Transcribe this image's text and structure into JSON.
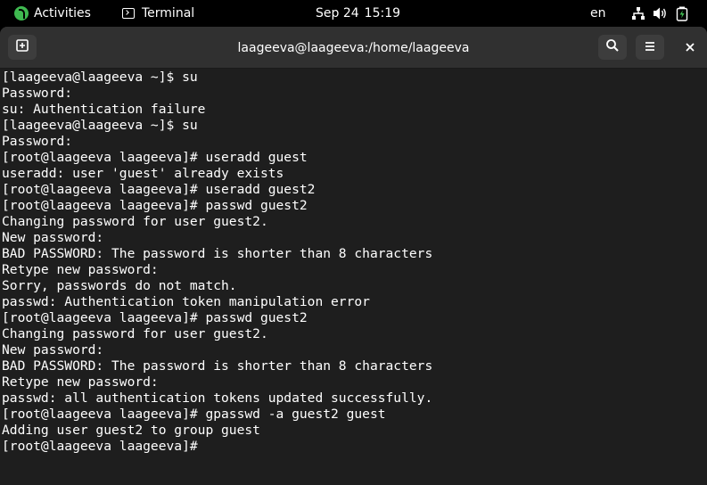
{
  "topbar": {
    "activities_label": "Activities",
    "app_label": "Terminal",
    "date": "Sep 24",
    "time": "15:19",
    "lang": "en"
  },
  "window": {
    "title": "laageeva@laageeva:/home/laageeva"
  },
  "terminal": {
    "lines": [
      "[laageeva@laageeva ~]$ su",
      "Password:",
      "su: Authentication failure",
      "[laageeva@laageeva ~]$ su",
      "Password:",
      "[root@laageeva laageeva]# useradd guest",
      "useradd: user 'guest' already exists",
      "[root@laageeva laageeva]# useradd guest2",
      "[root@laageeva laageeva]# passwd guest2",
      "Changing password for user guest2.",
      "New password:",
      "BAD PASSWORD: The password is shorter than 8 characters",
      "Retype new password:",
      "Sorry, passwords do not match.",
      "passwd: Authentication token manipulation error",
      "[root@laageeva laageeva]# passwd guest2",
      "Changing password for user guest2.",
      "New password:",
      "BAD PASSWORD: The password is shorter than 8 characters",
      "Retype new password:",
      "passwd: all authentication tokens updated successfully.",
      "[root@laageeva laageeva]# gpasswd -a guest2 guest",
      "Adding user guest2 to group guest",
      "[root@laageeva laageeva]# "
    ]
  }
}
